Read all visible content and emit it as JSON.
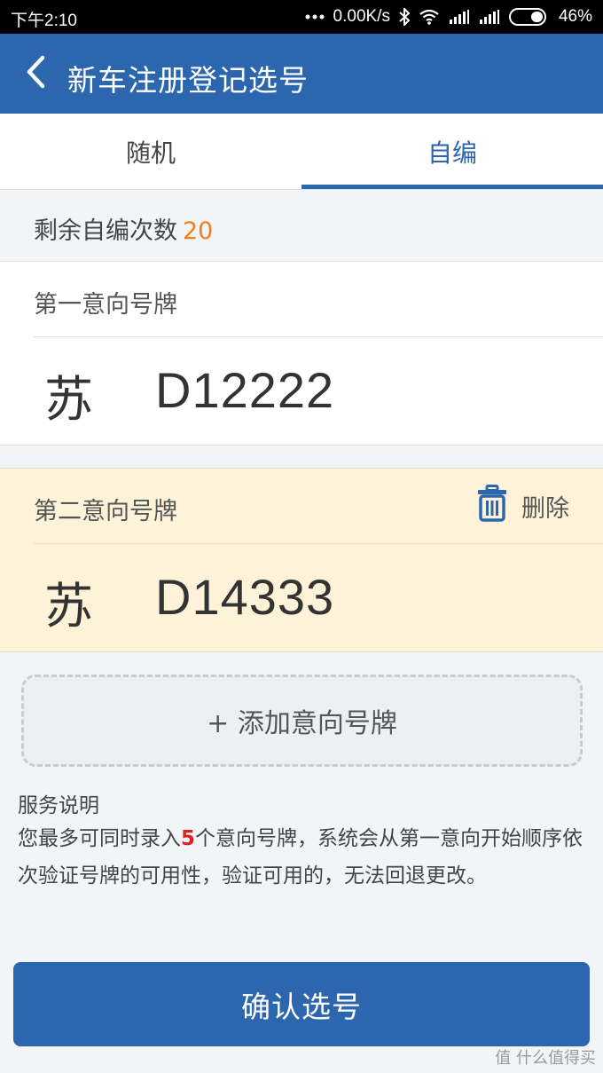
{
  "status_bar": {
    "time": "下午2:10",
    "network_speed": "0.00K/s",
    "battery": "46%",
    "icons": [
      "more-dots-icon",
      "bluetooth-icon",
      "wifi-icon",
      "signal-icon",
      "signal-icon",
      "battery-icon"
    ]
  },
  "app_bar": {
    "title": "新车注册登记选号",
    "back_icon": "back-arrow-icon"
  },
  "tabs": [
    {
      "label": "随机",
      "active": false
    },
    {
      "label": "自编",
      "active": true
    }
  ],
  "remaining": {
    "label": "剩余自编次数",
    "count": "20"
  },
  "plates": [
    {
      "label": "第一意向号牌",
      "province": "苏",
      "number": "D12222"
    },
    {
      "label": "第二意向号牌",
      "province": "苏",
      "number": "D14333",
      "delete_label": "删除",
      "delete_icon": "trash-icon"
    }
  ],
  "add_plate_label": "+ 添加意向号牌",
  "service": {
    "title": "服务说明",
    "text_before": "您最多可同时录入",
    "max_count": "5",
    "text_after": "个意向号牌，系统会从第一意向开始顺序依次验证号牌的可用性，验证可用的，无法回退更改。"
  },
  "confirm_label": "确认选号",
  "watermark": "值 什么值得买",
  "colors": {
    "primary": "#2c66ae",
    "highlight": "#f07f1a",
    "second_card_bg": "#fef2d9",
    "emphasis": "#e02020"
  }
}
